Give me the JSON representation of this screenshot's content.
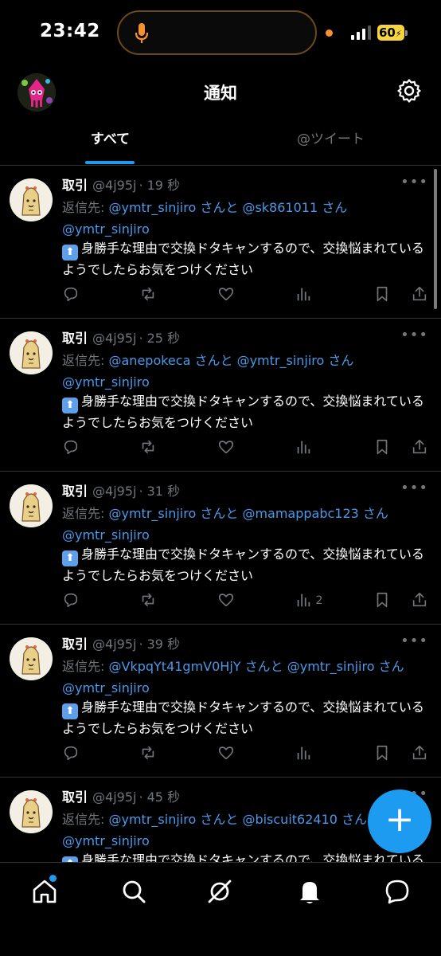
{
  "status_bar": {
    "time": "23:42",
    "battery": "60"
  },
  "header": {
    "title": "通知"
  },
  "tabs": [
    {
      "label": "すべて",
      "active": true
    },
    {
      "label": "@ツイート",
      "active": false
    }
  ],
  "tweets": [
    {
      "name": "取引",
      "handle": "@4j95j",
      "time": "· 19 秒",
      "reply_prefix": "返信先:",
      "reply_mention_1": "@ymtr_sinjiro",
      "reply_mid": "さんと",
      "reply_mention_2": "@sk861011",
      "reply_suffix": "さん",
      "body_mention": "@ymtr_sinjiro",
      "body_text": "身勝手な理由で交換ドタキャンするので、交換悩まれているようでしたらお気をつけください",
      "views": ""
    },
    {
      "name": "取引",
      "handle": "@4j95j",
      "time": "· 25 秒",
      "reply_prefix": "返信先:",
      "reply_mention_1": "@anepokeca",
      "reply_mid": "さんと",
      "reply_mention_2": "@ymtr_sinjiro",
      "reply_suffix": "さん",
      "body_mention": "@ymtr_sinjiro",
      "body_text": "身勝手な理由で交換ドタキャンするので、交換悩まれているようでしたらお気をつけください",
      "views": ""
    },
    {
      "name": "取引",
      "handle": "@4j95j",
      "time": "· 31 秒",
      "reply_prefix": "返信先:",
      "reply_mention_1": "@ymtr_sinjiro",
      "reply_mid": "さんと",
      "reply_mention_2": "@mamappabc123",
      "reply_suffix": "さん",
      "body_mention": "@ymtr_sinjiro",
      "body_text": "身勝手な理由で交換ドタキャンするので、交換悩まれているようでしたらお気をつけください",
      "views": "2"
    },
    {
      "name": "取引",
      "handle": "@4j95j",
      "time": "· 39 秒",
      "reply_prefix": "返信先:",
      "reply_mention_1": "@VkpqYt41gmV0HjY",
      "reply_mid": "さんと",
      "reply_mention_2": "@ymtr_sinjiro",
      "reply_suffix": "さん",
      "body_mention": "@ymtr_sinjiro",
      "body_text": "身勝手な理由で交換ドタキャンするので、交換悩まれているようでしたらお気をつけください",
      "views": ""
    },
    {
      "name": "取引",
      "handle": "@4j95j",
      "time": "· 45 秒",
      "reply_prefix": "返信先:",
      "reply_mention_1": "@ymtr_sinjiro",
      "reply_mid": "さんと",
      "reply_mention_2": "@biscuit62410",
      "reply_suffix": "さん",
      "body_mention": "@ymtr_sinjiro",
      "body_text": "身勝手な理由で交換ドタキャンするので、交換悩まれているようでしたらお気をつけください",
      "views": ""
    }
  ],
  "fab": {
    "label": "+"
  },
  "bottom_nav": [
    "home-icon",
    "search-icon",
    "spaces-icon",
    "notifications-icon",
    "messages-icon"
  ],
  "colors": {
    "accent": "#1d9bf0",
    "mention": "#4a99e9",
    "muted": "#71767b"
  }
}
